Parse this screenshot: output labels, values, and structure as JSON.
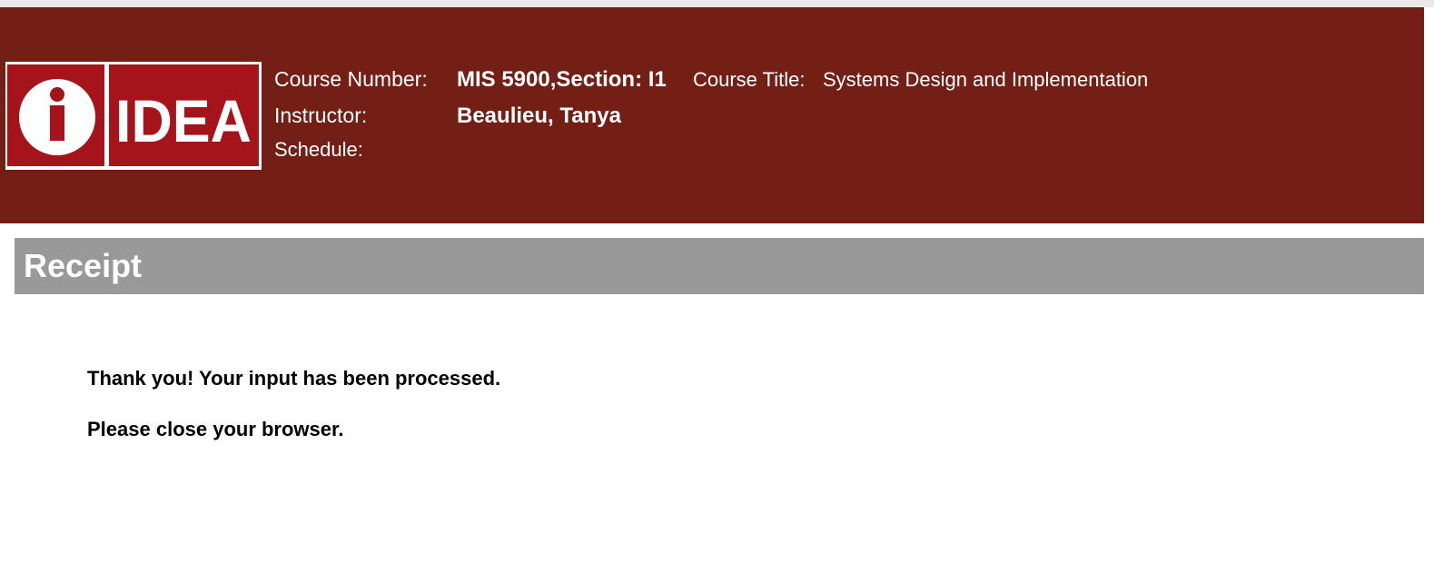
{
  "header": {
    "logo_text": "IDEA",
    "course_number_label": "Course Number:",
    "course_number_value": "MIS 5900,Section: I1",
    "course_title_label": "Course Title:",
    "course_title_value": "Systems Design and Implementation",
    "instructor_label": "Instructor:",
    "instructor_value": "Beaulieu, Tanya",
    "schedule_label": "Schedule:",
    "schedule_value": ""
  },
  "receipt": {
    "title": "Receipt",
    "message_1": "Thank you! Your input has been processed.",
    "message_2": "Please close your browser."
  },
  "colors": {
    "header_bg": "#731f16",
    "logo_red": "#a5141b",
    "receipt_bar": "#999999"
  }
}
